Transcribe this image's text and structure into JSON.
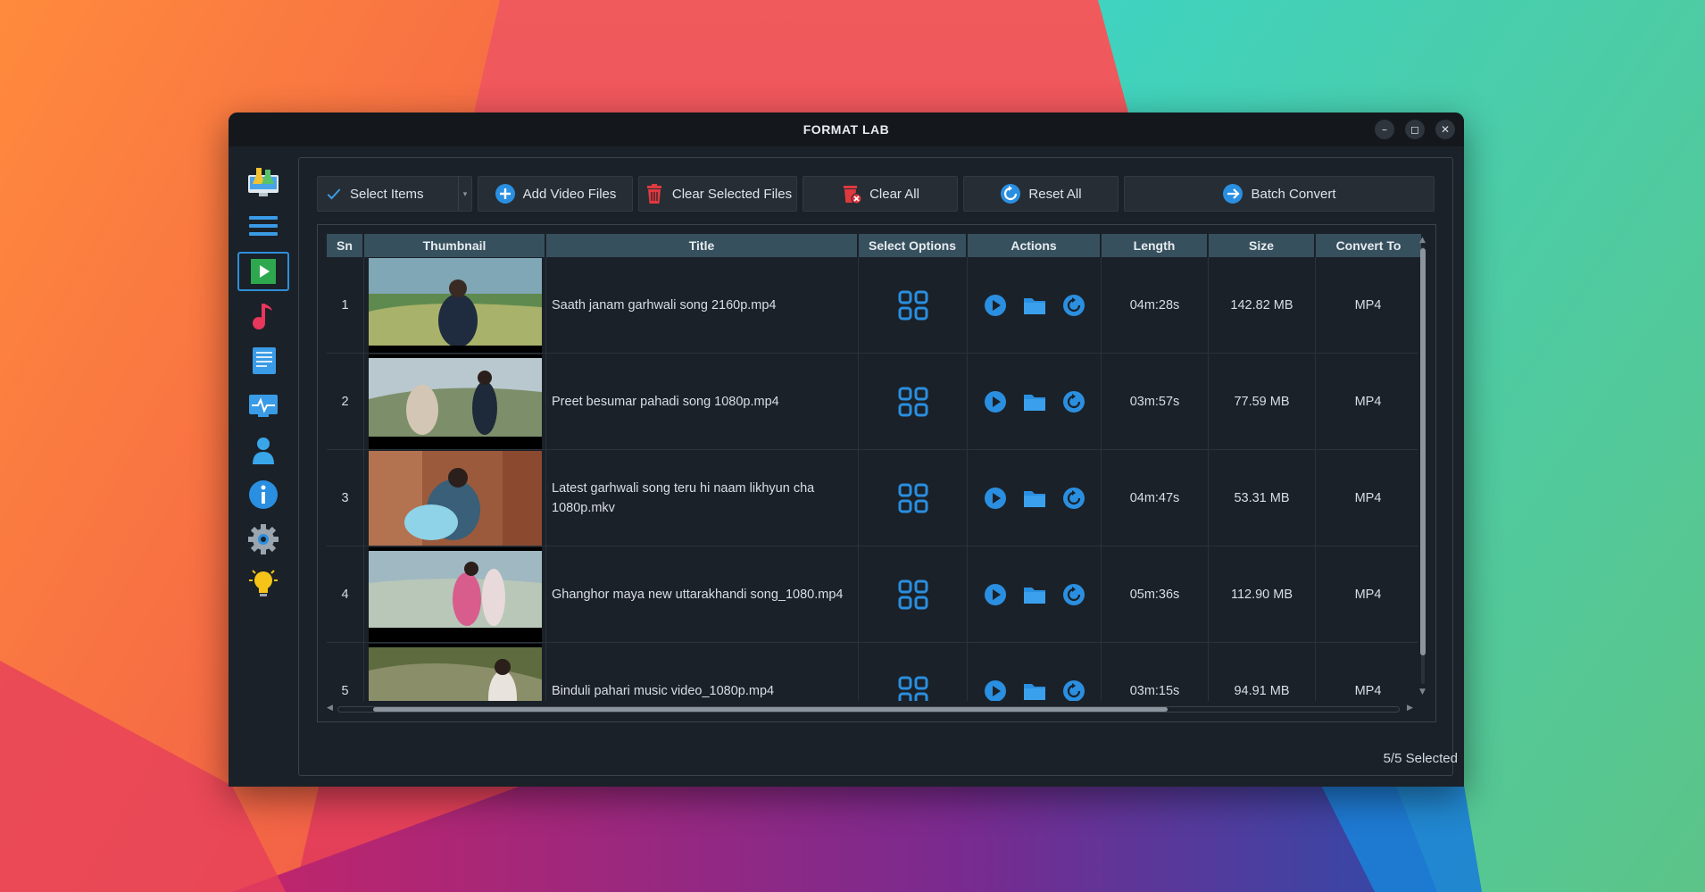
{
  "window": {
    "title": "FORMAT LAB"
  },
  "colors": {
    "accent": "#2f8fd9",
    "danger": "#e0393e",
    "header_bg": "#37505e",
    "window_bg": "#1b2128"
  },
  "sidebar": {
    "items": [
      {
        "icon": "lab-monitor-icon"
      },
      {
        "icon": "menu-icon"
      },
      {
        "icon": "video-play-icon",
        "active": true
      },
      {
        "icon": "music-note-icon"
      },
      {
        "icon": "document-icon"
      },
      {
        "icon": "monitor-pulse-icon"
      },
      {
        "icon": "user-icon"
      },
      {
        "icon": "info-icon"
      },
      {
        "icon": "settings-gear-icon"
      },
      {
        "icon": "lightbulb-icon"
      }
    ]
  },
  "toolbar": {
    "select_items": "Select Items",
    "add_video_files": "Add Video Files",
    "clear_selected_files": "Clear Selected Files",
    "clear_all": "Clear All",
    "reset_all": "Reset All",
    "batch_convert": "Batch Convert"
  },
  "table": {
    "headers": [
      "Sn",
      "Thumbnail",
      "Title",
      "Select Options",
      "Actions",
      "Length",
      "Size",
      "Convert To"
    ],
    "rows": [
      {
        "sn": "1",
        "title": "Saath janam garhwali song 2160p.mp4",
        "length": "04m:28s",
        "size": "142.82 MB",
        "convert_to": "MP4"
      },
      {
        "sn": "2",
        "title": "Preet besumar pahadi song 1080p.mp4",
        "length": "03m:57s",
        "size": "77.59 MB",
        "convert_to": "MP4"
      },
      {
        "sn": "3",
        "title": "Latest garhwali song teru hi naam likhyun cha 1080p.mkv",
        "length": "04m:47s",
        "size": "53.31 MB",
        "convert_to": "MP4"
      },
      {
        "sn": "4",
        "title": "Ghanghor maya new uttarakhandi song_1080.mp4",
        "length": "05m:36s",
        "size": "112.90 MB",
        "convert_to": "MP4"
      },
      {
        "sn": "5",
        "title": "Binduli pahari music video_1080p.mp4",
        "length": "03m:15s",
        "size": "94.91 MB",
        "convert_to": "MP4"
      }
    ]
  },
  "status": {
    "selected": "5/5 Selected"
  }
}
